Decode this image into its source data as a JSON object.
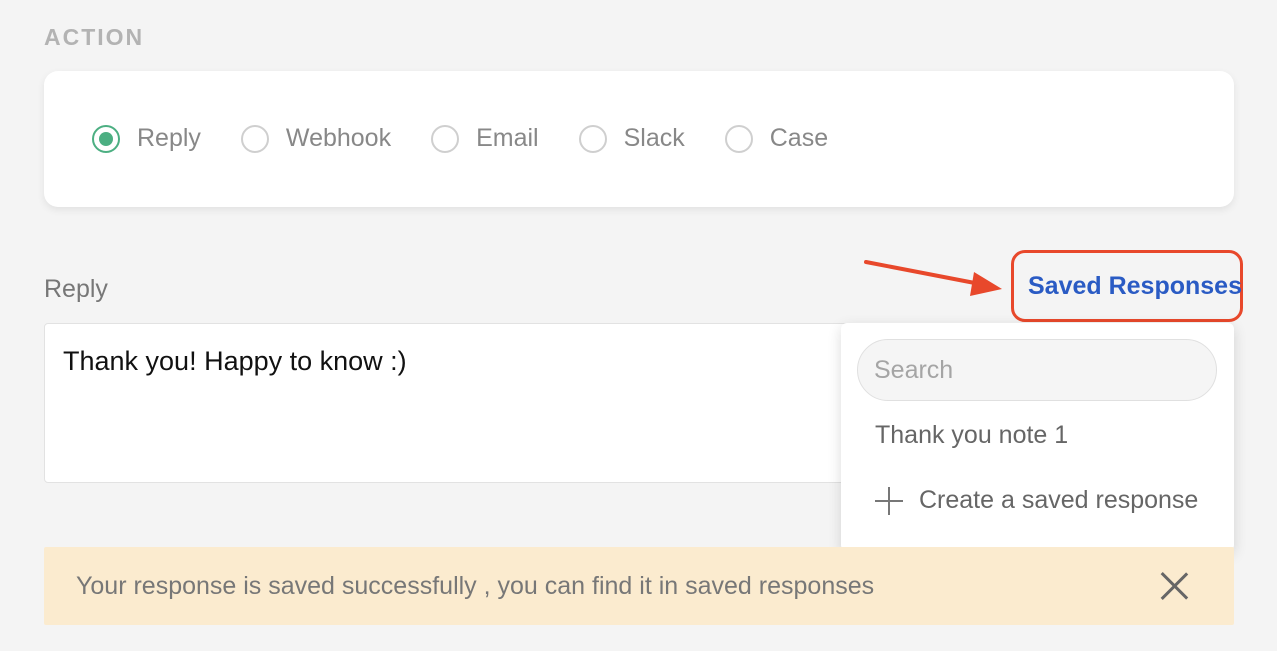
{
  "section": {
    "label": "ACTION"
  },
  "action": {
    "options": [
      {
        "label": "Reply",
        "checked": true
      },
      {
        "label": "Webhook",
        "checked": false
      },
      {
        "label": "Email",
        "checked": false
      },
      {
        "label": "Slack",
        "checked": false
      },
      {
        "label": "Case",
        "checked": false
      }
    ],
    "accent_color": "#4caf82"
  },
  "reply": {
    "label": "Reply",
    "value": "Thank you! Happy to know :)"
  },
  "saved_responses": {
    "link_label": "Saved Responses",
    "link_color": "#2a5bc4",
    "highlight_color": "#e8482b",
    "search_placeholder": "Search",
    "items": [
      {
        "label": "Thank you note 1"
      }
    ],
    "create_label": "Create a saved response",
    "create_icon": "plus-icon"
  },
  "notice": {
    "text": "Your response is saved successfully , you can find it in saved responses",
    "background": "#fbebcf",
    "close_icon": "close-icon"
  }
}
